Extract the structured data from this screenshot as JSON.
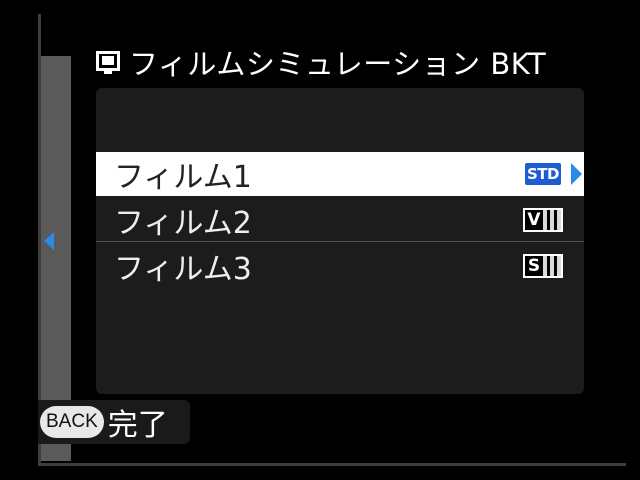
{
  "screen": {
    "title": "フィルムシミュレーション BKT",
    "title_icon": "film-simulation-icon"
  },
  "menu": {
    "items": [
      {
        "label": "フィルム1",
        "badge": "STD",
        "icon": "film-std-icon",
        "selected": true
      },
      {
        "label": "フィルム2",
        "badge": "V",
        "icon": "film-velvia-icon",
        "selected": false
      },
      {
        "label": "フィルム3",
        "badge": "S",
        "icon": "film-soft-icon",
        "selected": false
      }
    ]
  },
  "footer": {
    "back_label": "BACK",
    "done_label": "完了"
  },
  "colors": {
    "accent": "#2a8ae6",
    "std_badge": "#1f5bd1",
    "selected_row": "#ffffff",
    "panel": "#1c1c1c"
  }
}
